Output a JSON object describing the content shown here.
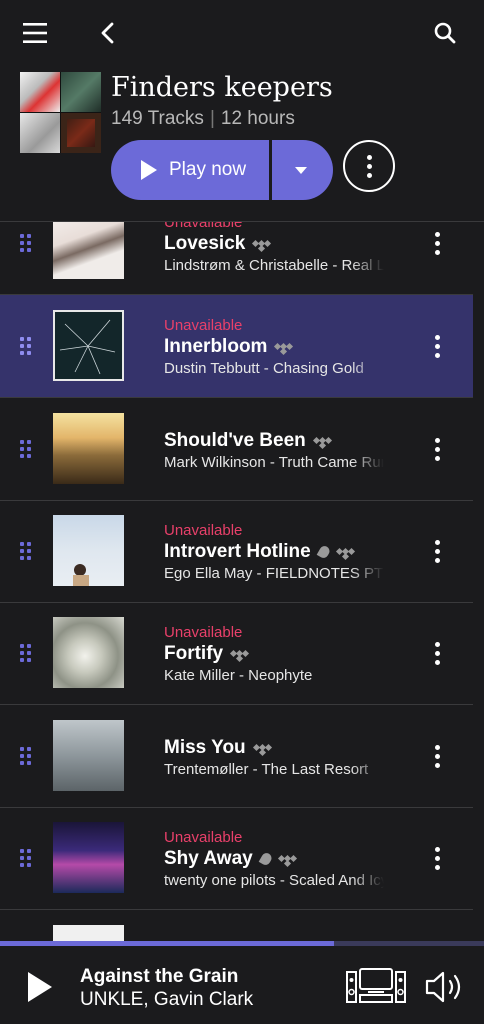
{
  "topbar": {
    "menu_icon": "hamburger-menu-icon",
    "back_icon": "chevron-left-icon",
    "search_icon": "search-icon"
  },
  "playlist": {
    "title": "Finders keepers",
    "tracks": "149 Tracks",
    "separator": "|",
    "duration": "12 hours",
    "play_label": "Play now"
  },
  "tracks": [
    {
      "unavailable": "Unavailable",
      "title": "Lovesick",
      "subtitle": "Lindstrøm & Christabelle - Real Life Is No Cool",
      "has_lyrics": false
    },
    {
      "unavailable": "Unavailable",
      "title": "Innerbloom",
      "subtitle": "Dustin Tebbutt - Chasing Gold",
      "has_lyrics": false
    },
    {
      "unavailable": "",
      "title": "Should've Been",
      "subtitle": "Mark Wilkinson - Truth Came Running",
      "has_lyrics": false
    },
    {
      "unavailable": "Unavailable",
      "title": "Introvert Hotline",
      "subtitle": "Ego Ella May - FIELDNOTES PT II",
      "has_lyrics": true
    },
    {
      "unavailable": "Unavailable",
      "title": "Fortify",
      "subtitle": "Kate Miller - Neophyte",
      "has_lyrics": false
    },
    {
      "unavailable": "",
      "title": "Miss You",
      "subtitle": "Trentemøller - The Last Resort",
      "has_lyrics": false
    },
    {
      "unavailable": "Unavailable",
      "title": "Shy Away",
      "subtitle": "twenty one pilots - Scaled And Icy",
      "has_lyrics": true
    }
  ],
  "now_playing": {
    "title": "Against the Grain",
    "artist": "UNKLE, Gavin Clark",
    "progress": 0.69,
    "device_icon": "speaker-system-icon",
    "volume_icon": "volume-icon"
  },
  "colors": {
    "accent": "#6c6ad8",
    "unavailable": "#e8406a",
    "background": "#1b1b1d",
    "selected_row": "#35336b"
  }
}
